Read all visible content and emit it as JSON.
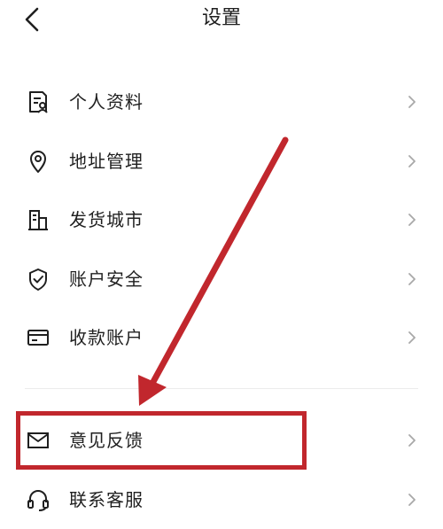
{
  "header": {
    "title": "设置",
    "back_icon": "chevron-left-icon"
  },
  "settings": {
    "items": [
      {
        "label": "个人资料",
        "icon": "profile-doc-icon"
      },
      {
        "label": "地址管理",
        "icon": "location-pin-icon"
      },
      {
        "label": "发货城市",
        "icon": "building-icon"
      },
      {
        "label": "账户安全",
        "icon": "shield-check-icon"
      },
      {
        "label": "收款账户",
        "icon": "card-icon"
      }
    ],
    "items2": [
      {
        "label": "意见反馈",
        "icon": "mail-icon",
        "highlighted": true
      },
      {
        "label": "联系客服",
        "icon": "headset-icon"
      }
    ]
  },
  "annotation": {
    "color": "#c1272d",
    "arrow_target": "意见反馈"
  }
}
